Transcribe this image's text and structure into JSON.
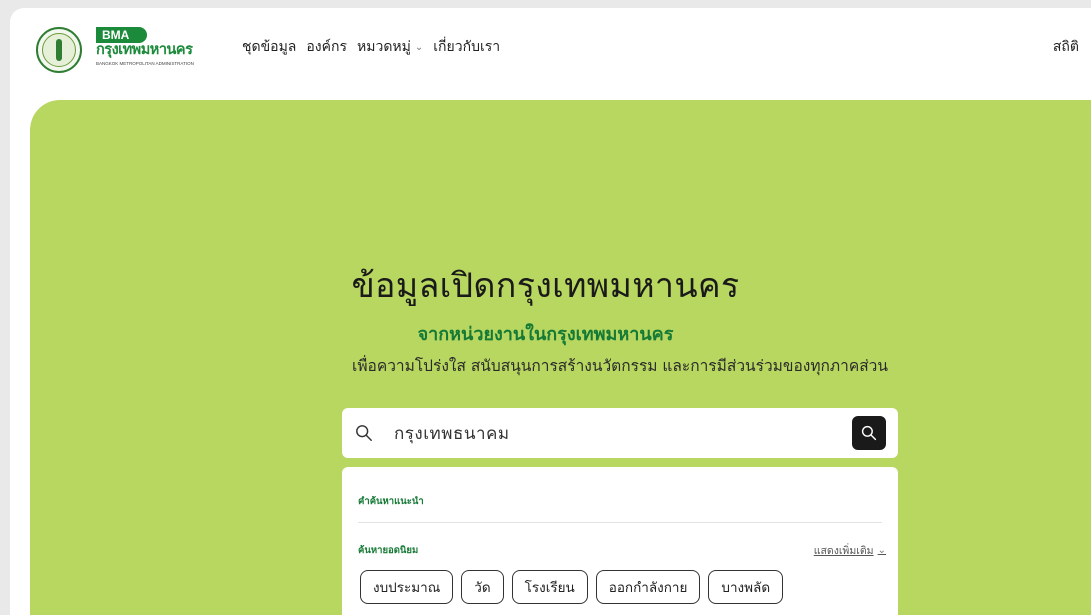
{
  "logo": {
    "abbr": "BMA",
    "name": "กรุงเทพมหานคร",
    "subtitle": "BANGKOK METROPOLITAN ADMINISTRATION"
  },
  "nav": {
    "items": [
      "ชุดข้อมูล",
      "องค์กร",
      "หมวดหมู่",
      "เกี่ยวกับเรา"
    ],
    "right": "สถิติ"
  },
  "hero": {
    "title": "ข้อมูลเปิดกรุงเทพมหานคร",
    "subtitle": "จากหน่วยงานในกรุงเทพมหานคร",
    "description": "เพื่อความโปร่งใส สนับสนุนการสร้างนวัตกรรม และการมีส่วนร่วมของทุกภาคส่วน"
  },
  "search": {
    "value": "กรุงเทพธนาคม",
    "suggest_label": "คำค้นหาแนะนำ",
    "popular_label": "ค้นหายอดนิยม",
    "show_more": "แสดงเพิ่มเติม",
    "tags": [
      "งบประมาณ",
      "วัด",
      "โรงเรียน",
      "ออกกำลังกาย",
      "บางพลัด"
    ]
  },
  "colors": {
    "hero_bg": "#b8d760",
    "brand_green": "#157a35",
    "search_button": "#1a1a1a"
  }
}
